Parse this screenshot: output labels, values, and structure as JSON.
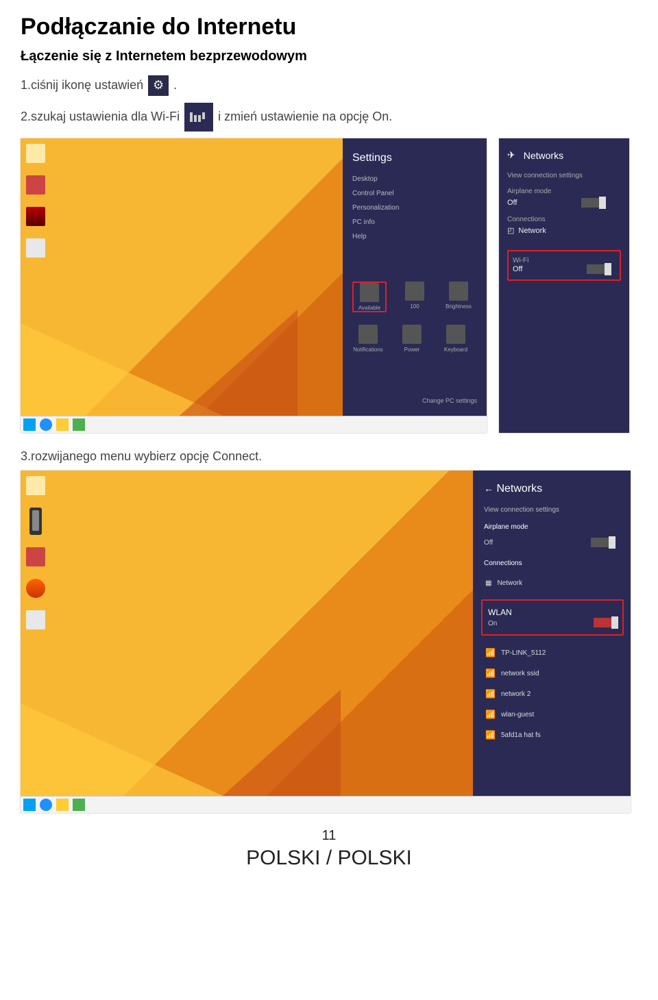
{
  "page": {
    "heading": "Podłączanie do Internetu",
    "subtitle": "Łączenie się z Internetem bezprzewodowym",
    "step1_a": "1.ciśnij ikonę ustawień ",
    "step1_b": ".",
    "step2_a": "2.szukaj ustawienia dla Wi-Fi ",
    "step2_b": " i zmień ustawienie na opcję On.",
    "step3": "3.rozwijanego menu wybierz opcję Connect.",
    "page_number": "11",
    "footer": "POLSKI / POLSKI"
  },
  "settings_panel": {
    "title": "Settings",
    "items": [
      "Desktop",
      "Control Panel",
      "Personalization",
      "PC info",
      "Help"
    ],
    "tile_avail": "Available",
    "tile_vol": "100",
    "tile_bright": "Brightness",
    "tile_notif": "Notifications",
    "tile_power": "Power",
    "tile_kbd": "Keyboard",
    "change": "Change PC settings"
  },
  "networks_panel": {
    "title": "Networks",
    "view_settings": "View connection settings",
    "airplane_label": "Airplane mode",
    "airplane_value": "Off",
    "connections_label": "Connections",
    "conn_name": "Network",
    "wifi_label": "Wi-Fi",
    "wifi_value": "Off",
    "wlan_label": "WLAN",
    "wlan_value": "On",
    "nets": [
      "TP-LINK_5112",
      "network ssid",
      "network 2",
      "wlan-guest",
      "5afd1a hat fs"
    ]
  }
}
